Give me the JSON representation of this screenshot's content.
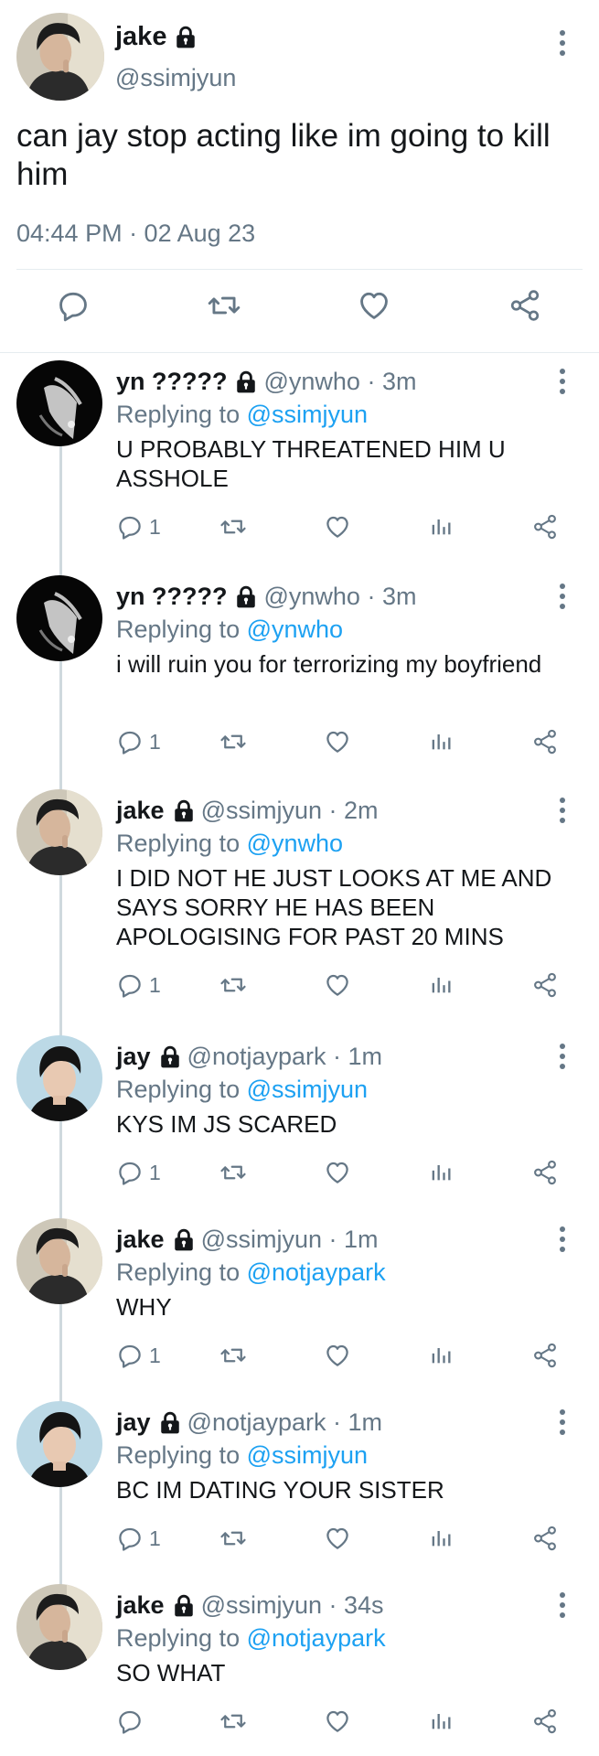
{
  "main_tweet": {
    "name": "jake",
    "handle": "@ssimjyun",
    "text": "can jay stop acting like im going to kill him",
    "timestamp": "04:44 PM · 02 Aug 23",
    "icons": [
      "lock-icon",
      "more-icon",
      "reply-icon",
      "retweet-icon",
      "like-icon",
      "share-icon"
    ]
  },
  "replies": [
    {
      "name": "yn ?????",
      "handle": "@ynwho",
      "time": "3m",
      "replying_prefix": "Replying to",
      "replying_to": "@ssimjyun",
      "text": "U PROBABLY THREATENED HIM U ASSHOLE",
      "reply_count": "1",
      "avatar": "yn"
    },
    {
      "name": "yn ?????",
      "handle": "@ynwho",
      "time": "3m",
      "replying_prefix": "Replying to",
      "replying_to": "@ynwho",
      "text": "i will ruin you for terrorizing my boyfriend",
      "reply_count": "1",
      "avatar": "yn"
    },
    {
      "name": "jake",
      "handle": "@ssimjyun",
      "time": "2m",
      "replying_prefix": "Replying to",
      "replying_to": "@ynwho",
      "text": "I DID NOT HE JUST LOOKS AT ME AND SAYS SORRY HE HAS BEEN APOLOGISING FOR PAST 20 MINS",
      "reply_count": "1",
      "avatar": "jake"
    },
    {
      "name": "jay",
      "handle": "@notjaypark",
      "time": "1m",
      "replying_prefix": "Replying to",
      "replying_to": "@ssimjyun",
      "text": "KYS IM JS SCARED",
      "reply_count": "1",
      "avatar": "jay"
    },
    {
      "name": "jake",
      "handle": "@ssimjyun",
      "time": "1m",
      "replying_prefix": "Replying to",
      "replying_to": "@notjaypark",
      "text": "WHY",
      "reply_count": "1",
      "avatar": "jake"
    },
    {
      "name": "jay",
      "handle": "@notjaypark",
      "time": "1m",
      "replying_prefix": "Replying to",
      "replying_to": "@ssimjyun",
      "text": "BC IM DATING YOUR SISTER",
      "reply_count": "1",
      "avatar": "jay"
    },
    {
      "name": "jake",
      "handle": "@ssimjyun",
      "time": "34s",
      "replying_prefix": "Replying to",
      "replying_to": "@notjaypark",
      "text": "SO WHAT",
      "reply_count": "",
      "avatar": "jake"
    }
  ],
  "colors": {
    "accent": "#1da1f2",
    "muted": "#657786",
    "text": "#14171a",
    "divider": "#e6ecf0"
  }
}
